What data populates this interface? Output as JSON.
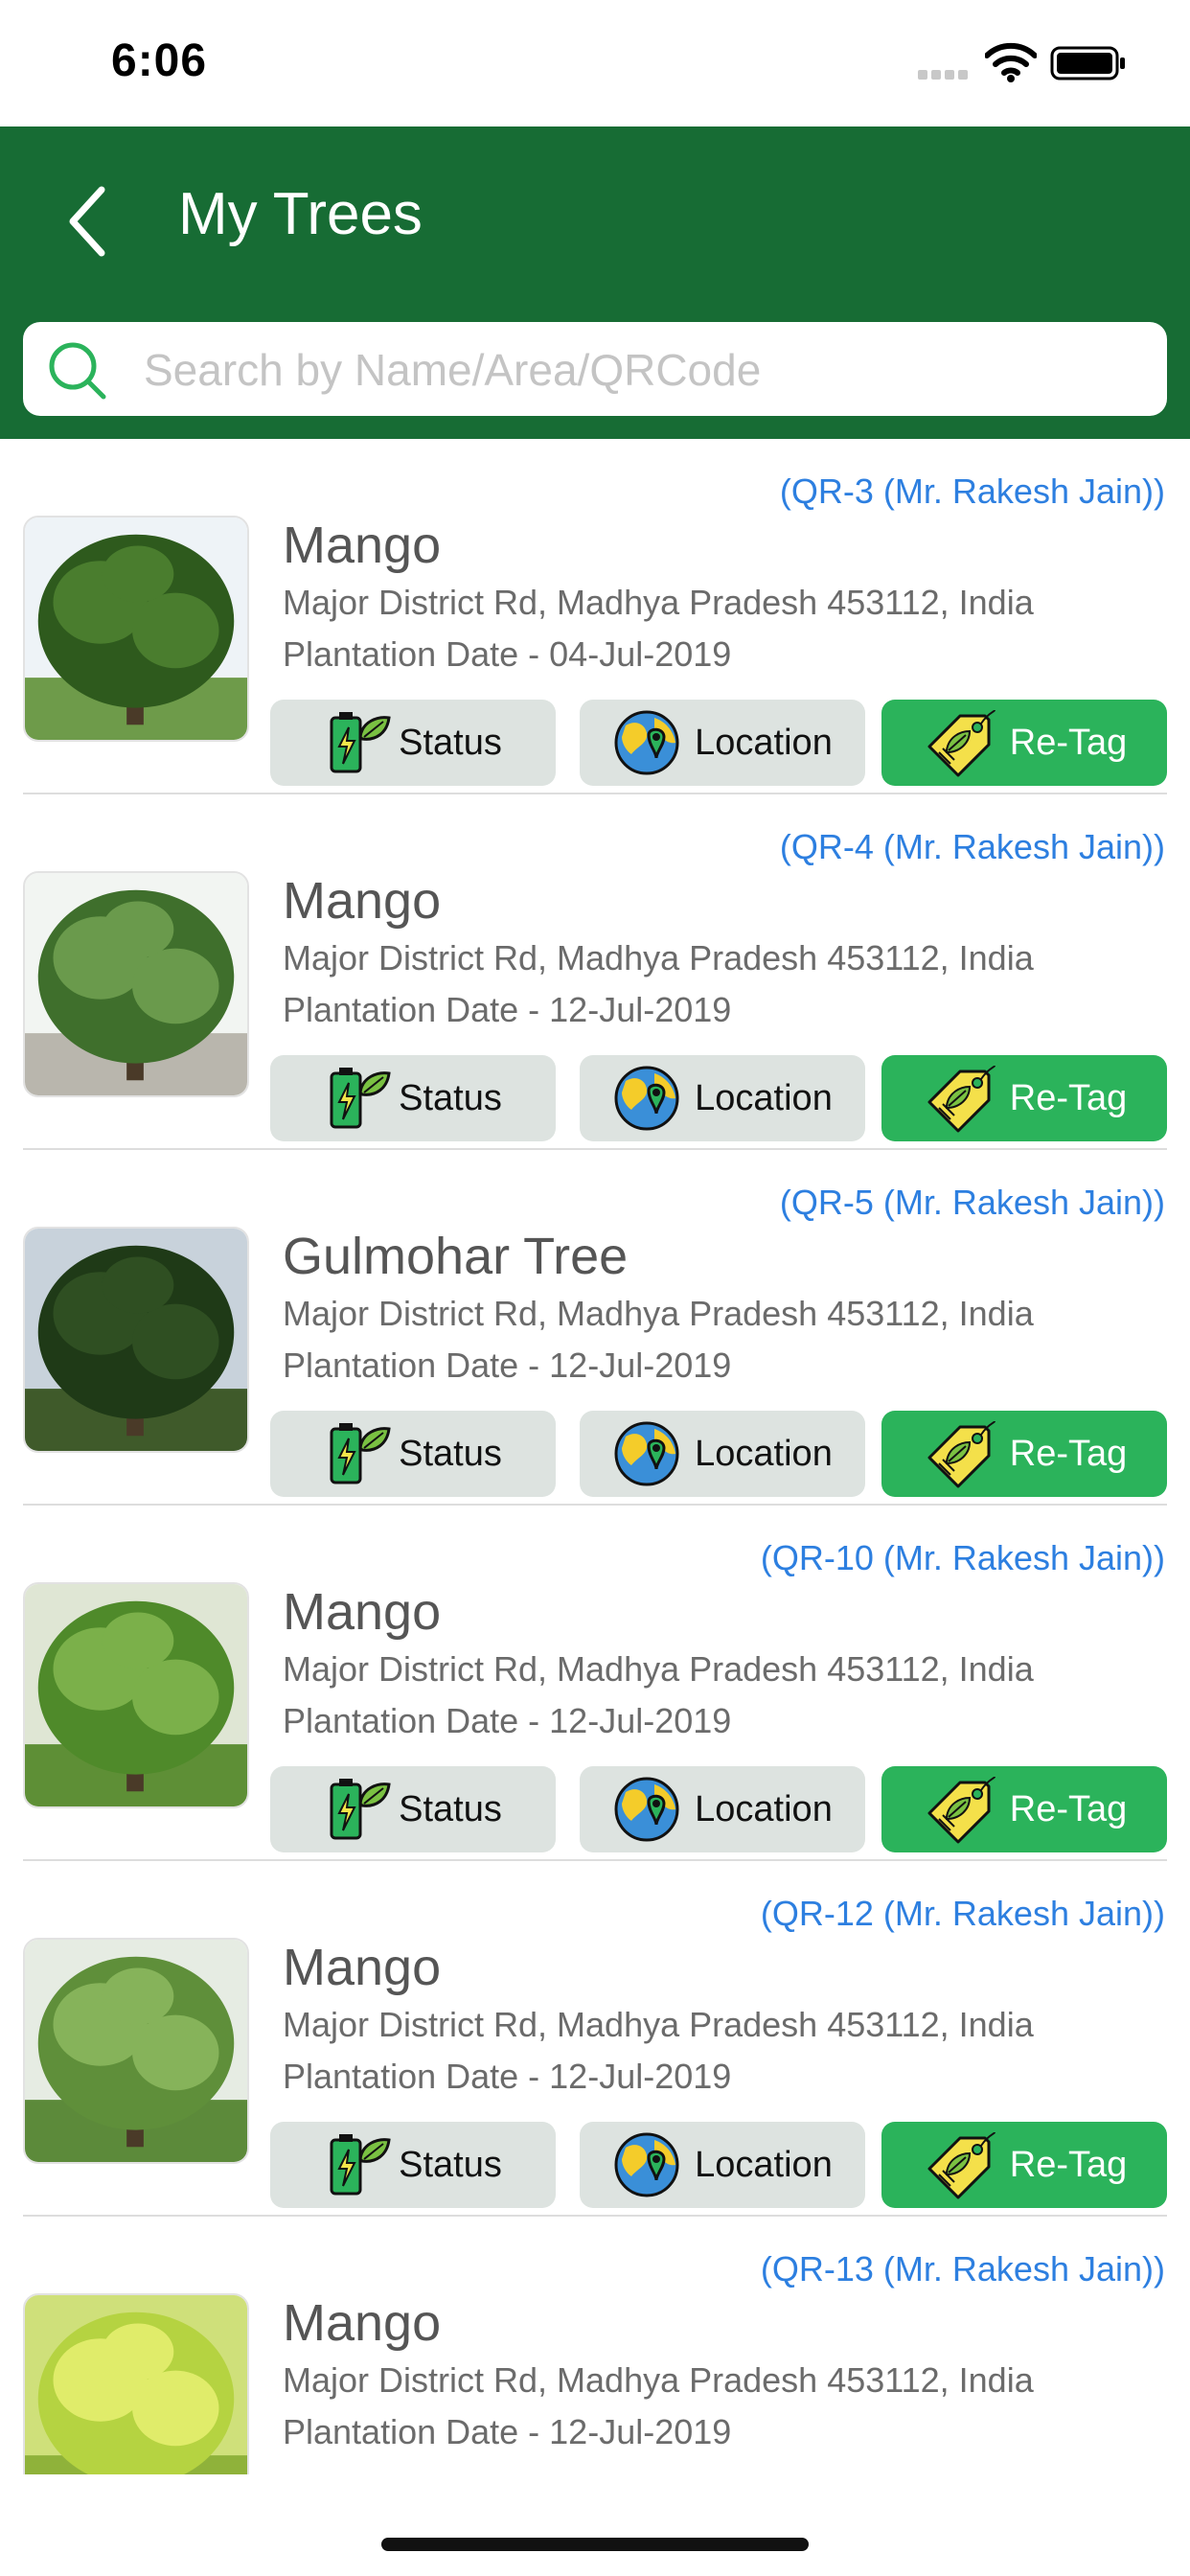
{
  "status_bar": {
    "time": "6:06"
  },
  "header": {
    "title": "My Trees"
  },
  "search": {
    "placeholder": "Search by Name/Area/QRCode",
    "value": ""
  },
  "buttons": {
    "status": "Status",
    "location": "Location",
    "retag": "Re-Tag"
  },
  "trees": [
    {
      "qr": "(QR-3 (Mr. Rakesh Jain))",
      "name": "Mango",
      "address": "Major District Rd, Madhya Pradesh 453112, India",
      "plantation": "Plantation Date - 04-Jul-2019"
    },
    {
      "qr": "(QR-4 (Mr. Rakesh Jain))",
      "name": "Mango",
      "address": "Major District Rd, Madhya Pradesh 453112, India",
      "plantation": "Plantation Date - 12-Jul-2019"
    },
    {
      "qr": "(QR-5 (Mr. Rakesh Jain))",
      "name": "Gulmohar Tree",
      "address": "Major District Rd, Madhya Pradesh 453112, India",
      "plantation": "Plantation Date - 12-Jul-2019"
    },
    {
      "qr": "(QR-10 (Mr. Rakesh Jain))",
      "name": "Mango",
      "address": "Major District Rd, Madhya Pradesh 453112, India",
      "plantation": "Plantation Date - 12-Jul-2019"
    },
    {
      "qr": "(QR-12 (Mr. Rakesh Jain))",
      "name": "Mango",
      "address": "Major District Rd, Madhya Pradesh 453112, India",
      "plantation": "Plantation Date - 12-Jul-2019"
    },
    {
      "qr": "(QR-13 (Mr. Rakesh Jain))",
      "name": "Mango",
      "address": "Major District Rd, Madhya Pradesh 453112, India",
      "plantation": "Plantation Date - 12-Jul-2019"
    }
  ],
  "icons": {
    "back": "chevron-left-icon",
    "search": "search-icon",
    "status": "battery-leaf-icon",
    "location": "globe-pin-icon",
    "retag": "leaf-tag-icon"
  },
  "colors": {
    "header": "#176c34",
    "accent_green": "#2bb35b",
    "qr_link": "#2d7fe0",
    "button_grey": "#dde3e0"
  }
}
